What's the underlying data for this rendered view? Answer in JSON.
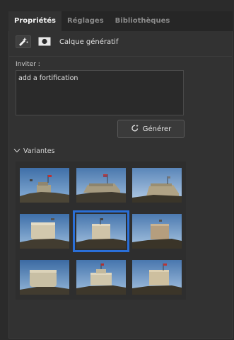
{
  "tabs": [
    {
      "label": "Propriétés",
      "active": true
    },
    {
      "label": "Réglages",
      "active": false
    },
    {
      "label": "Bibliothèques",
      "active": false
    }
  ],
  "layer": {
    "type_label": "Calque génératif"
  },
  "prompt": {
    "label": "Inviter :",
    "value": "add a fortification"
  },
  "generate": {
    "label": "Générer"
  },
  "variants": {
    "label": "Variantes",
    "count": 9,
    "selected_index": 4
  },
  "colors": {
    "accent": "#2a6fd8",
    "panel": "#323232",
    "tabbar": "#262626"
  },
  "icons": [
    "generative-layer-icon",
    "mask-icon",
    "refresh-sparkle-icon",
    "chevron-down-icon"
  ]
}
